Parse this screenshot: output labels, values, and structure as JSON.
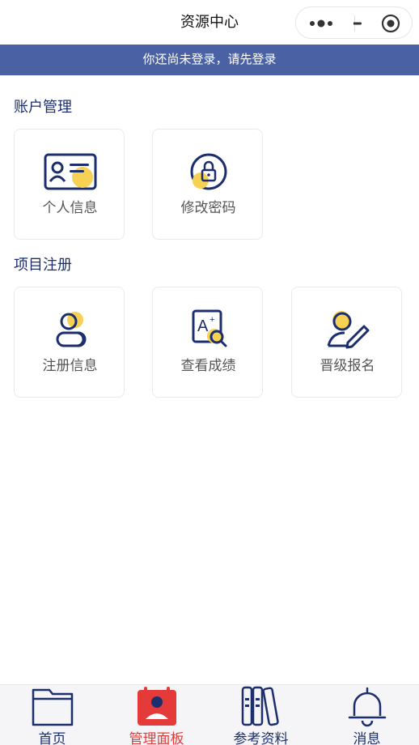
{
  "navbar": {
    "title": "资源中心",
    "more_icon": "more-dots-icon",
    "minimize_icon": "minimize-icon",
    "close_icon": "target-close-icon"
  },
  "banner": {
    "text": "你还尚未登录，请先登录",
    "background": "#4a62a4"
  },
  "account_section": {
    "title": "账户管理",
    "items": [
      {
        "label": "个人信息",
        "icon": "id-card-icon"
      },
      {
        "label": "修改密码",
        "icon": "lock-icon"
      }
    ]
  },
  "project_section": {
    "title": "项目注册",
    "items": [
      {
        "label": "注册信息",
        "icon": "users-icon"
      },
      {
        "label": "查看成绩",
        "icon": "grade-search-icon"
      },
      {
        "label": "晋级报名",
        "icon": "user-edit-icon"
      }
    ]
  },
  "tabbar": {
    "items": [
      {
        "label": "首页",
        "icon": "folder-icon",
        "active": false
      },
      {
        "label": "管理面板",
        "icon": "calendar-user-icon",
        "active": true
      },
      {
        "label": "参考资料",
        "icon": "books-icon",
        "active": false
      },
      {
        "label": "消息",
        "icon": "bell-icon",
        "active": false
      }
    ]
  },
  "colors": {
    "primary": "#1c2e6e",
    "accent_yellow": "#f7d154",
    "active_red": "#e53a3a"
  }
}
